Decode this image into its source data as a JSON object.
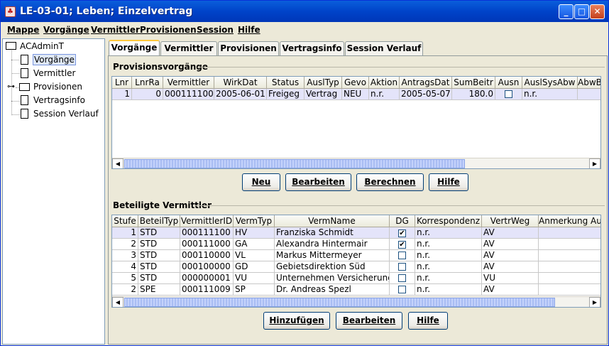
{
  "window": {
    "title": "LE-03-01; Leben; Einzelvertrag",
    "app_icon": "app-icon",
    "minimize": "_",
    "maximize": "□",
    "close": "✕"
  },
  "menu": [
    "Mappe",
    "Vorgänge",
    "Vermittler",
    "Provisionen",
    "Session",
    "Hilfe"
  ],
  "tree": {
    "root": "ACAdminT",
    "items": [
      "Vorgänge",
      "Vermittler",
      "Provisionen",
      "Vertragsinfo",
      "Session Verlauf"
    ]
  },
  "tabs": [
    "Vorgänge",
    "Vermittler",
    "Provisionen",
    "Vertragsinfo",
    "Session Verlauf"
  ],
  "provisions": {
    "title": "Provisionsvorgänge",
    "columns": [
      "Lnr",
      "LnrRa",
      "Vermittler",
      "WirkDat",
      "Status",
      "AuslTyp",
      "Gevo",
      "Aktion",
      "AntragsDat",
      "SumBeitr",
      "Ausn",
      "AuslSysAbw",
      "AbwB"
    ],
    "rows": [
      {
        "lnr": "1",
        "lnrra": "0",
        "vermittler": "000111100",
        "wirkdat": "2005-06-01",
        "status": "Freigeg",
        "ausltyp": "Vertrag",
        "gevo": "NEU",
        "aktion": "n.r.",
        "antragsdat": "2005-05-07",
        "sumbeitr": "180.0",
        "ausn": false,
        "auslsysabw": "n.r.",
        "abwb": ""
      }
    ],
    "buttons": [
      "Neu",
      "Bearbeiten",
      "Berechnen",
      "Hilfe"
    ]
  },
  "brokers": {
    "title": "Beteiligte Vermittler",
    "columns": [
      "Stufe",
      "BeteilTyp",
      "VermittlerID",
      "VermTyp",
      "VermName",
      "DG",
      "Korrespondenz",
      "VertrWeg",
      "Anmerkung Au"
    ],
    "rows": [
      {
        "stufe": "1",
        "typ": "STD",
        "id": "000111100",
        "vermtyp": "HV",
        "name": "Franziska Schmidt",
        "dg": true,
        "korr": "n.r.",
        "weg": "AV",
        "anm": ""
      },
      {
        "stufe": "2",
        "typ": "STD",
        "id": "000111000",
        "vermtyp": "GA",
        "name": "Alexandra Hintermair",
        "dg": true,
        "korr": "n.r.",
        "weg": "AV",
        "anm": ""
      },
      {
        "stufe": "3",
        "typ": "STD",
        "id": "000110000",
        "vermtyp": "VL",
        "name": "Markus Mittermeyer",
        "dg": false,
        "korr": "n.r.",
        "weg": "AV",
        "anm": ""
      },
      {
        "stufe": "4",
        "typ": "STD",
        "id": "000100000",
        "vermtyp": "GD",
        "name": "Gebietsdirektion Süd",
        "dg": false,
        "korr": "n.r.",
        "weg": "AV",
        "anm": ""
      },
      {
        "stufe": "5",
        "typ": "STD",
        "id": "000000001",
        "vermtyp": "VU",
        "name": "Unternehmen Versicherung",
        "dg": false,
        "korr": "n.r.",
        "weg": "VU",
        "anm": ""
      },
      {
        "stufe": "2",
        "typ": "SPE",
        "id": "000111009",
        "vermtyp": "SP",
        "name": "Dr. Andreas Spezl",
        "dg": false,
        "korr": "n.r.",
        "weg": "AV",
        "anm": ""
      }
    ],
    "buttons": [
      "Hinzufügen",
      "Bearbeiten",
      "Hilfe"
    ]
  },
  "scroll": {
    "left": "◀",
    "right": "▶"
  },
  "check_mark": "✔"
}
